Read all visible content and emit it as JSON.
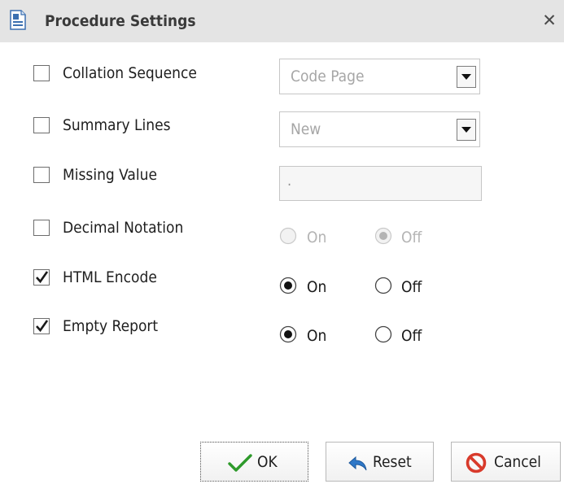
{
  "window": {
    "title": "Procedure Settings",
    "title_icon": "document-settings-icon",
    "close_icon": "close-x-icon"
  },
  "settings": [
    {
      "label": "Collation Sequence",
      "checked": false,
      "control": "dropdown",
      "value": "Code Page"
    },
    {
      "label": "Summary Lines",
      "checked": false,
      "control": "dropdown",
      "value": "New"
    },
    {
      "label": "Missing Value",
      "checked": false,
      "control": "text",
      "value": "."
    },
    {
      "label": "Decimal Notation",
      "checked": false,
      "control": "radio",
      "disabled": true,
      "options": [
        "On",
        "Off"
      ],
      "selected": "Off"
    },
    {
      "label": "HTML Encode",
      "checked": true,
      "control": "radio",
      "disabled": false,
      "options": [
        "On",
        "Off"
      ],
      "selected": "On"
    },
    {
      "label": "Empty Report",
      "checked": true,
      "control": "radio",
      "disabled": false,
      "options": [
        "On",
        "Off"
      ],
      "selected": "On"
    }
  ],
  "buttons": {
    "ok": {
      "label": "OK",
      "icon": "green-checkmark-icon"
    },
    "reset": {
      "label": "Reset",
      "icon": "undo-arrow-icon"
    },
    "cancel": {
      "label": "Cancel",
      "icon": "no-entry-icon"
    }
  },
  "colors": {
    "titlebar": "#e4e4e4",
    "ok_check": "#2e9a2b",
    "reset_arrow": "#2f78c8",
    "cancel_icon": "#d83a2b"
  }
}
